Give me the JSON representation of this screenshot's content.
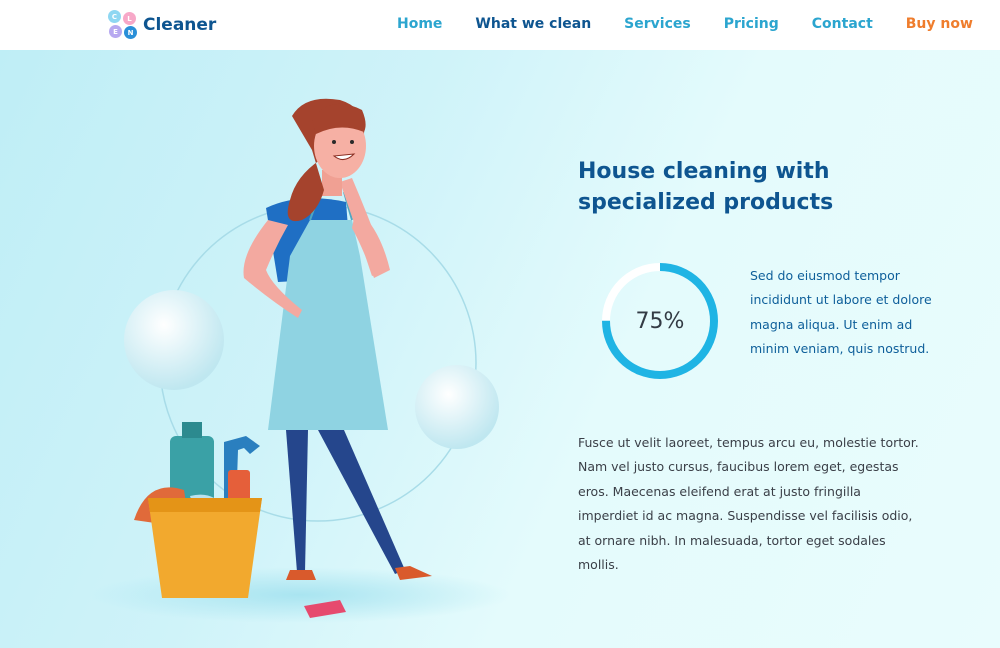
{
  "brand": {
    "name": "Cleaner",
    "mark_letters": [
      "C",
      "L",
      "E",
      "N"
    ],
    "mark_colors": [
      "#8fd7f2",
      "#f7a8c8",
      "#b7a9f0",
      "#2a8fd8"
    ]
  },
  "nav": {
    "items": [
      {
        "label": "Home",
        "color": "#2ba5cf"
      },
      {
        "label": "What we clean",
        "color": "#0e5590"
      },
      {
        "label": "Services",
        "color": "#2ba5cf"
      },
      {
        "label": "Pricing",
        "color": "#2ba5cf"
      },
      {
        "label": "Contact",
        "color": "#2ba5cf"
      },
      {
        "label": "Buy now",
        "color": "#ef7d2d"
      }
    ]
  },
  "hero": {
    "headline_line1": "House cleaning with",
    "headline_line2": "specialized products",
    "progress": {
      "percent": 75,
      "label": "75%",
      "color": "#1fb4e4",
      "track_color": "#ffffff"
    },
    "side_paragraph": "Sed do eiusmod tempor incididunt ut labore et dolore magna aliqua. Ut enim ad minim veniam, quis nostrud.",
    "body_paragraph": "Fusce ut velit laoreet, tempus arcu eu, molestie tortor. Nam vel justo cursus, faucibus lorem eget, egestas eros. Maecenas eleifend erat at justo fringilla imperdiet id ac magna. Suspendisse vel facilisis odio, at ornare nibh. In malesuada, tortor eget sodales mollis."
  },
  "colors": {
    "primary": "#0e5590",
    "accent": "#2ba5cf",
    "buy": "#ef7d2d"
  }
}
